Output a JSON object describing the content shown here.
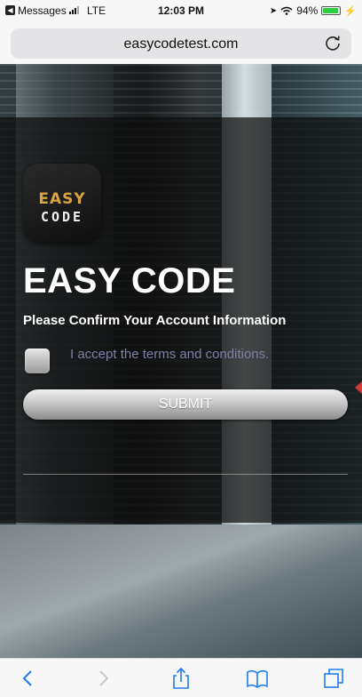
{
  "status_bar": {
    "carrier": "Messages",
    "network": "LTE",
    "time": "12:03 PM",
    "battery_percent": "94%",
    "battery_level": 0.94,
    "battery_color": "#2ecc40"
  },
  "browser": {
    "url": "easycodetest.com",
    "reload_icon": "reload-icon"
  },
  "page": {
    "logo": {
      "line1": "EASY",
      "line2": "CODE"
    },
    "title": "EASY CODE",
    "subtitle": "Please Confirm Your Account Information",
    "terms_label": "I accept the terms and conditions.",
    "terms_checked": false,
    "submit_label": "SUBMIT"
  },
  "toolbar": {
    "icons": [
      "back-icon",
      "forward-icon",
      "share-icon",
      "bookmarks-icon",
      "tabs-icon"
    ]
  },
  "colors": {
    "logo_gold": "#d9a441",
    "terms_text": "#7e7ea6"
  }
}
